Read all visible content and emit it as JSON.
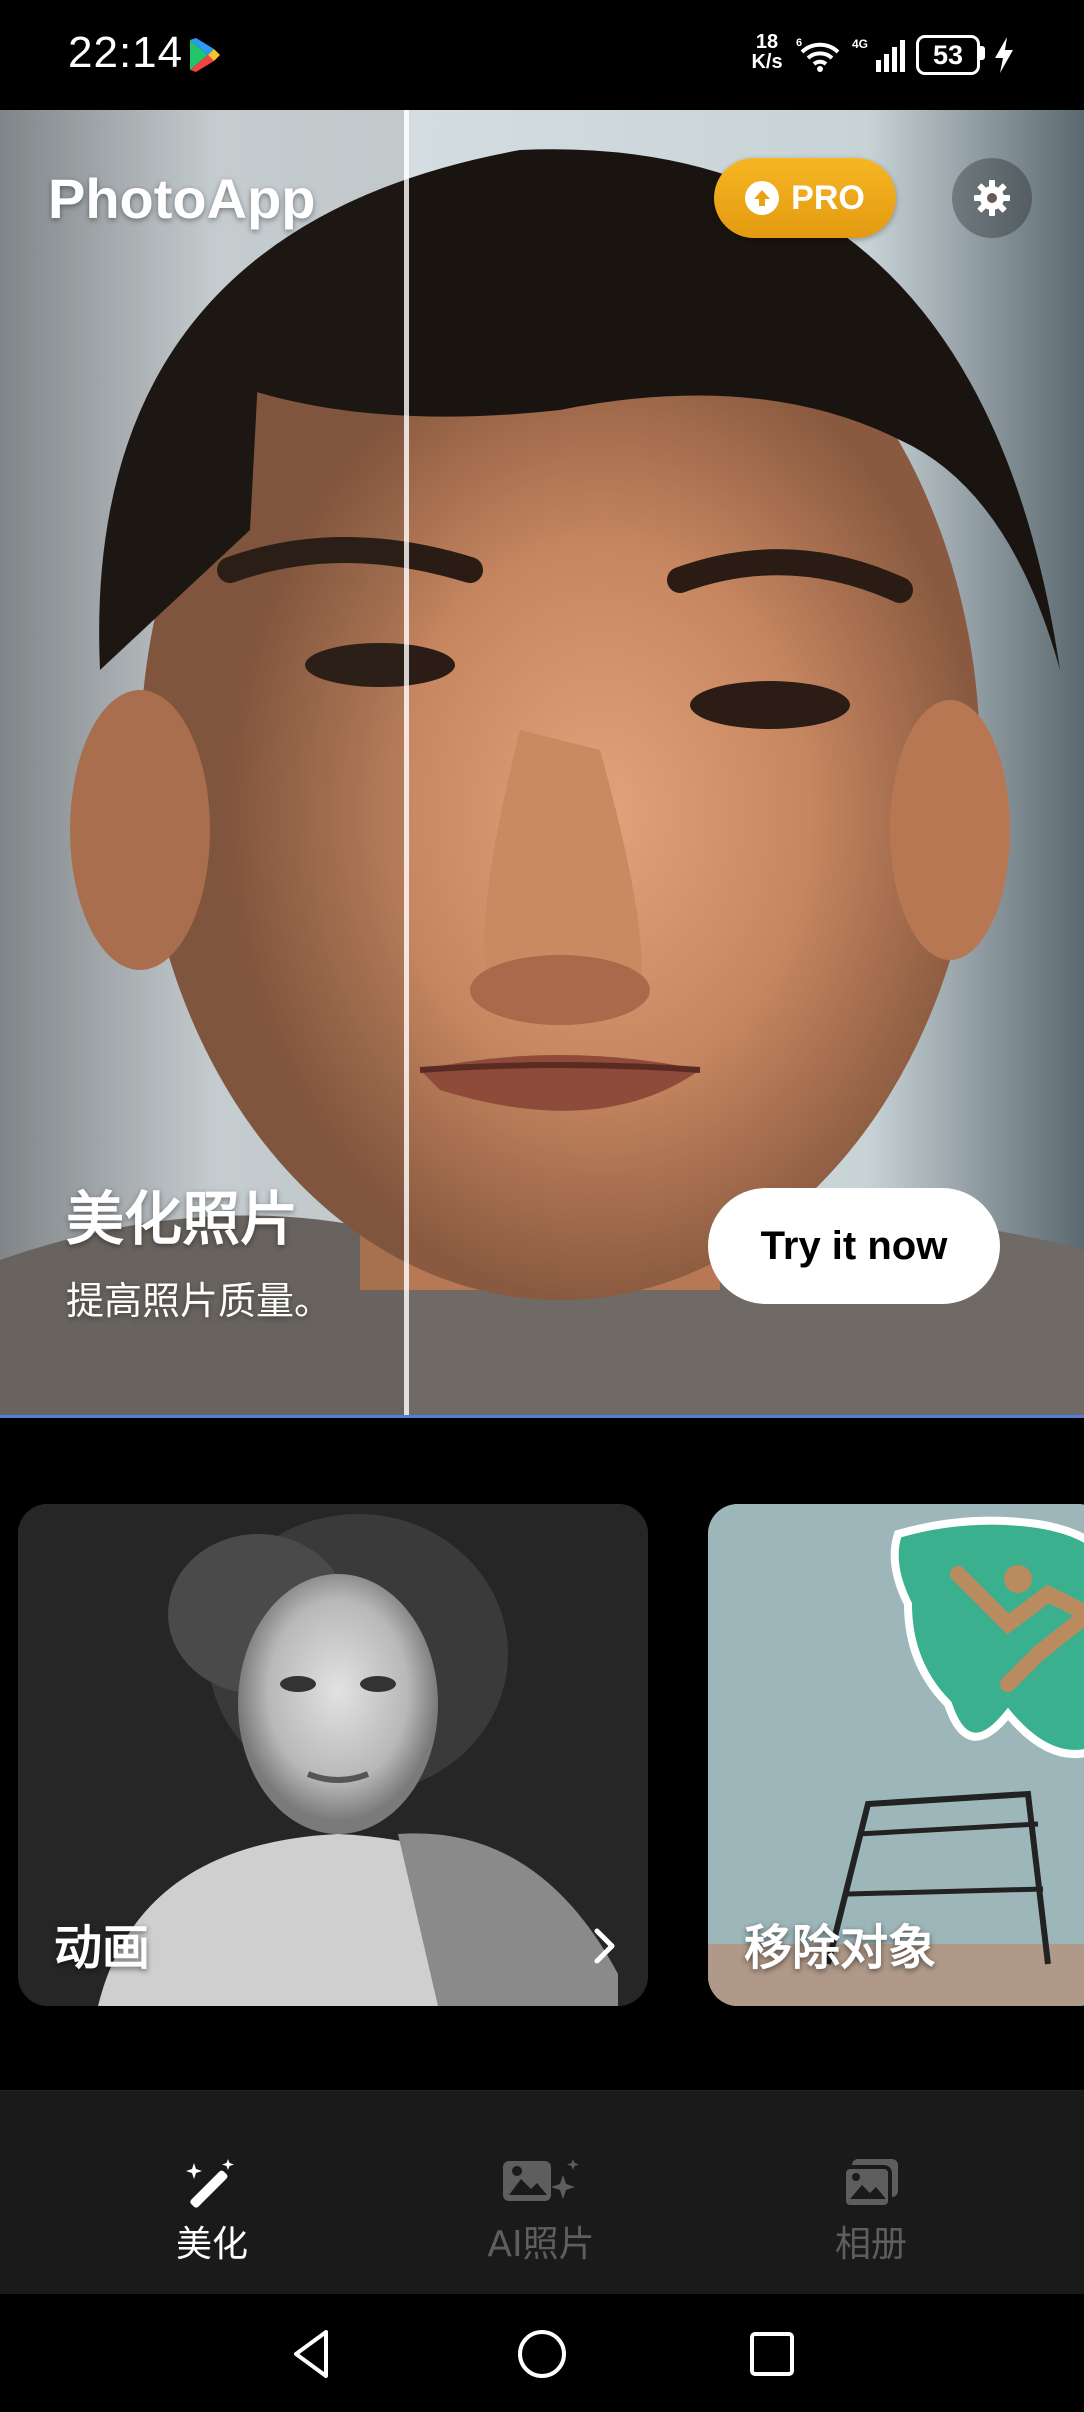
{
  "status_bar": {
    "time": "22:14",
    "speed_value": "18",
    "speed_unit": "K/s",
    "network_label": "4G",
    "wifi_label": "6",
    "battery": "53"
  },
  "header": {
    "app_title": "PhotoApp",
    "pro_label": "PRO"
  },
  "hero": {
    "heading": "美化照片",
    "subtitle": "提高照片质量。",
    "cta_label": "Try it now"
  },
  "cards": [
    {
      "label": "动画"
    },
    {
      "label": "移除对象"
    }
  ],
  "bottom_nav": {
    "items": [
      {
        "label": "美化",
        "icon": "magic-wand-icon",
        "active": true
      },
      {
        "label": "AI照片",
        "icon": "ai-photo-icon",
        "active": false
      },
      {
        "label": "相册",
        "icon": "album-icon",
        "active": false
      }
    ]
  },
  "colors": {
    "pro_gradient": "#f2a91c",
    "hero_divider": "#4f7fd8",
    "nav_background": "#1a1a1a",
    "nav_inactive": "#5e5e5e"
  }
}
